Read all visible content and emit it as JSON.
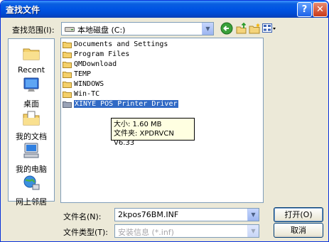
{
  "window": {
    "title": "查找文件"
  },
  "toolbar": {
    "look_in_label": "查找范围(I):",
    "look_in_value": "本地磁盘 (C:)",
    "icons": [
      "back-icon",
      "up-folder-icon",
      "new-folder-icon",
      "views-menu-icon"
    ]
  },
  "places": [
    {
      "name": "recent",
      "label": "Recent",
      "icon": "recent-folder-icon"
    },
    {
      "name": "desktop",
      "label": "桌面",
      "icon": "desktop-icon"
    },
    {
      "name": "my-documents",
      "label": "我的文档",
      "icon": "my-documents-icon"
    },
    {
      "name": "my-computer",
      "label": "我的电脑",
      "icon": "my-computer-icon"
    },
    {
      "name": "network",
      "label": "网上邻居",
      "icon": "network-icon"
    }
  ],
  "files": [
    {
      "name": "Documents and Settings",
      "selected": false
    },
    {
      "name": "Program Files",
      "selected": false
    },
    {
      "name": "QMDownload",
      "selected": false
    },
    {
      "name": "TEMP",
      "selected": false
    },
    {
      "name": "WINDOWS",
      "selected": false
    },
    {
      "name": "Win-TC",
      "selected": false
    },
    {
      "name": "XINYE POS Printer Driver",
      "selected": true
    }
  ],
  "tooltip": {
    "size_line": "大小: 1.60 MB",
    "folder_line": "文件夹: XPDRVCN V6.33"
  },
  "footer": {
    "filename_label": "文件名(N):",
    "filename_value": "2kpos76BM.INF",
    "filetype_label": "文件类型(T):",
    "filetype_value": "安装信息 (*.inf)",
    "open_label": "打开(O)",
    "cancel_label": "取消"
  },
  "colors": {
    "title_bar": "#0054e3",
    "selection": "#316ac5",
    "tooltip_bg": "#ffffe1",
    "dialog_bg": "#ece9d8"
  }
}
